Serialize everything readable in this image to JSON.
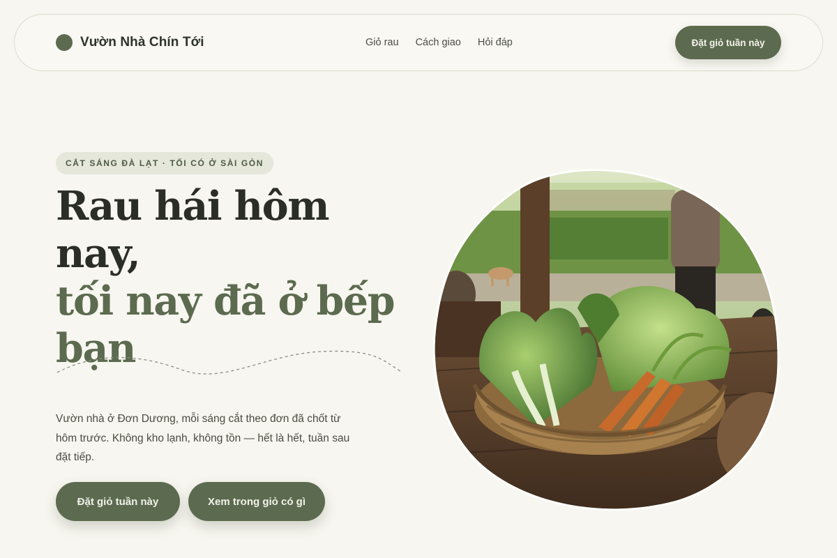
{
  "nav": {
    "brand": "Vườn Nhà Chín Tới",
    "links": [
      "Giỏ rau",
      "Cách giao",
      "Hỏi đáp"
    ],
    "cta": "Đặt giỏ tuần này"
  },
  "hero": {
    "eyebrow": "CẮT SÁNG ĐÀ LẠT · TỐI CÓ Ở SÀI GÒN",
    "headline_line1": "Rau hái hôm nay,",
    "headline_line2": "tối nay đã ở bếp bạn",
    "lede": "Vườn nhà ở Đơn Dương, mỗi sáng cắt theo đơn đã chốt từ hôm trước. Không kho lạnh, không tồn — hết là hết, tuần sau đặt tiếp.",
    "primary_button": "Đặt giỏ tuần này",
    "secondary_button": "Xem trong giỏ có gì"
  },
  "colors": {
    "background": "#f7f6f0",
    "accent": "#5c6b4f",
    "text_dark": "#2b2d27",
    "chip_bg": "#e4e7da"
  },
  "icons": {
    "brand": "brand-dot-icon"
  }
}
